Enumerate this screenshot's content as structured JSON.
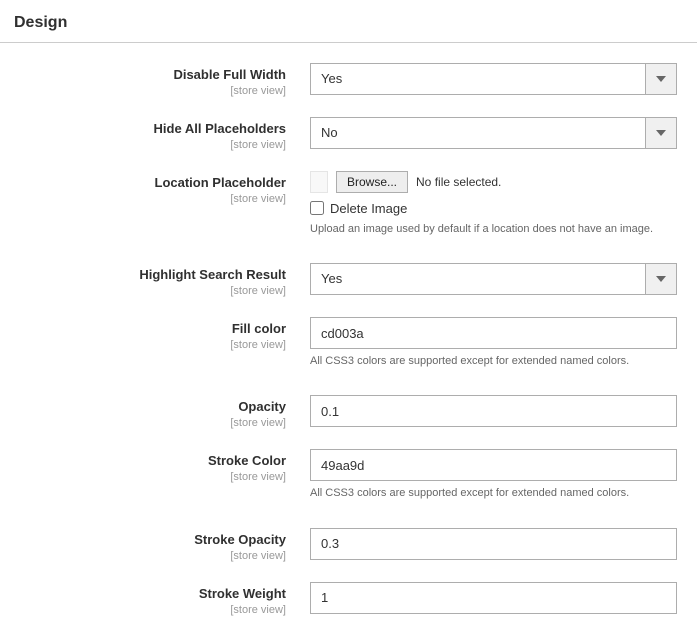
{
  "section": {
    "title": "Design"
  },
  "scope_label": "[store view]",
  "fields": {
    "disable_full_width": {
      "label": "Disable Full Width",
      "value": "Yes"
    },
    "hide_all_placeholders": {
      "label": "Hide All Placeholders",
      "value": "No"
    },
    "location_placeholder": {
      "label": "Location Placeholder",
      "browse_label": "Browse...",
      "no_file_text": "No file selected.",
      "delete_label": "Delete Image",
      "note": "Upload an image used by default if a location does not have an image."
    },
    "highlight_search_result": {
      "label": "Highlight Search Result",
      "value": "Yes"
    },
    "fill_color": {
      "label": "Fill color",
      "value": "cd003a",
      "note": "All CSS3 colors are supported except for extended named colors."
    },
    "opacity": {
      "label": "Opacity",
      "value": "0.1"
    },
    "stroke_color": {
      "label": "Stroke Color",
      "value": "49aa9d",
      "note": "All CSS3 colors are supported except for extended named colors."
    },
    "stroke_opacity": {
      "label": "Stroke Opacity",
      "value": "0.3"
    },
    "stroke_weight": {
      "label": "Stroke Weight",
      "value": "1"
    }
  }
}
